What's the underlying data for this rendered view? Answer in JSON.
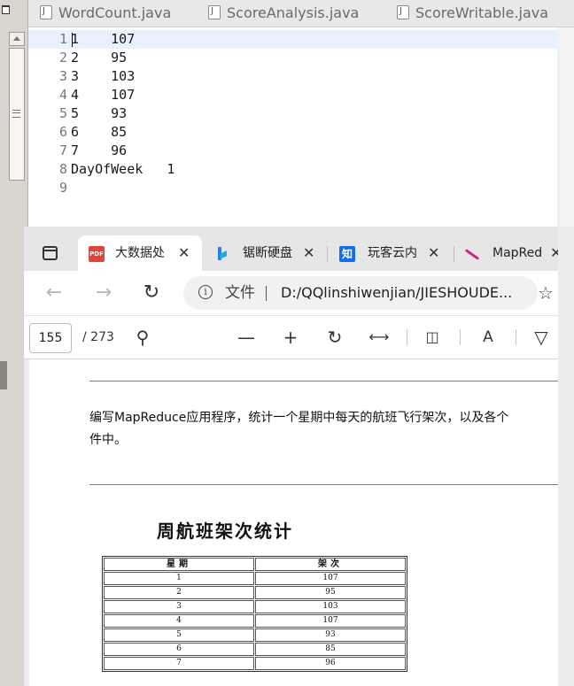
{
  "editor": {
    "tabs": [
      {
        "label": "WordCount.java"
      },
      {
        "label": "ScoreAnalysis.java"
      },
      {
        "label": "ScoreWritable.java"
      }
    ],
    "lines": [
      {
        "num": "1",
        "text": "1    107"
      },
      {
        "num": "2",
        "text": "2    95"
      },
      {
        "num": "3",
        "text": "3    103"
      },
      {
        "num": "4",
        "text": "4    107"
      },
      {
        "num": "5",
        "text": "5    93"
      },
      {
        "num": "6",
        "text": "6    85"
      },
      {
        "num": "7",
        "text": "7    96"
      },
      {
        "num": "8",
        "text": "DayOfWeek   1"
      },
      {
        "num": "9",
        "text": ""
      }
    ]
  },
  "browser": {
    "tabs": [
      {
        "label": "大数据处",
        "icon": "pdf-icon"
      },
      {
        "label": "锯断硬盘",
        "icon": "bing-icon"
      },
      {
        "label": "玩客云内",
        "icon": "zhihu-icon"
      },
      {
        "label": "MapRed",
        "icon": "mapreduce-icon"
      }
    ],
    "pdf_badge": "PDF",
    "zhihu_badge": "知",
    "address": {
      "label": "文件",
      "url": "D:/QQlinshiwenjian/JIESHOUDE..."
    },
    "pdf_toolbar": {
      "page_current": "155",
      "page_total": "/ 273"
    }
  },
  "document": {
    "paragraph_line1": "编写MapReduce应用程序，统计一个星期中每天的航班飞行架次，以及各个",
    "paragraph_line2": "件中。",
    "figure_title": "周航班架次统计",
    "table": {
      "headers": [
        "星期",
        "架次"
      ],
      "rows": [
        [
          "1",
          "107"
        ],
        [
          "2",
          "95"
        ],
        [
          "3",
          "103"
        ],
        [
          "4",
          "107"
        ],
        [
          "5",
          "93"
        ],
        [
          "6",
          "85"
        ],
        [
          "7",
          "96"
        ]
      ]
    }
  }
}
